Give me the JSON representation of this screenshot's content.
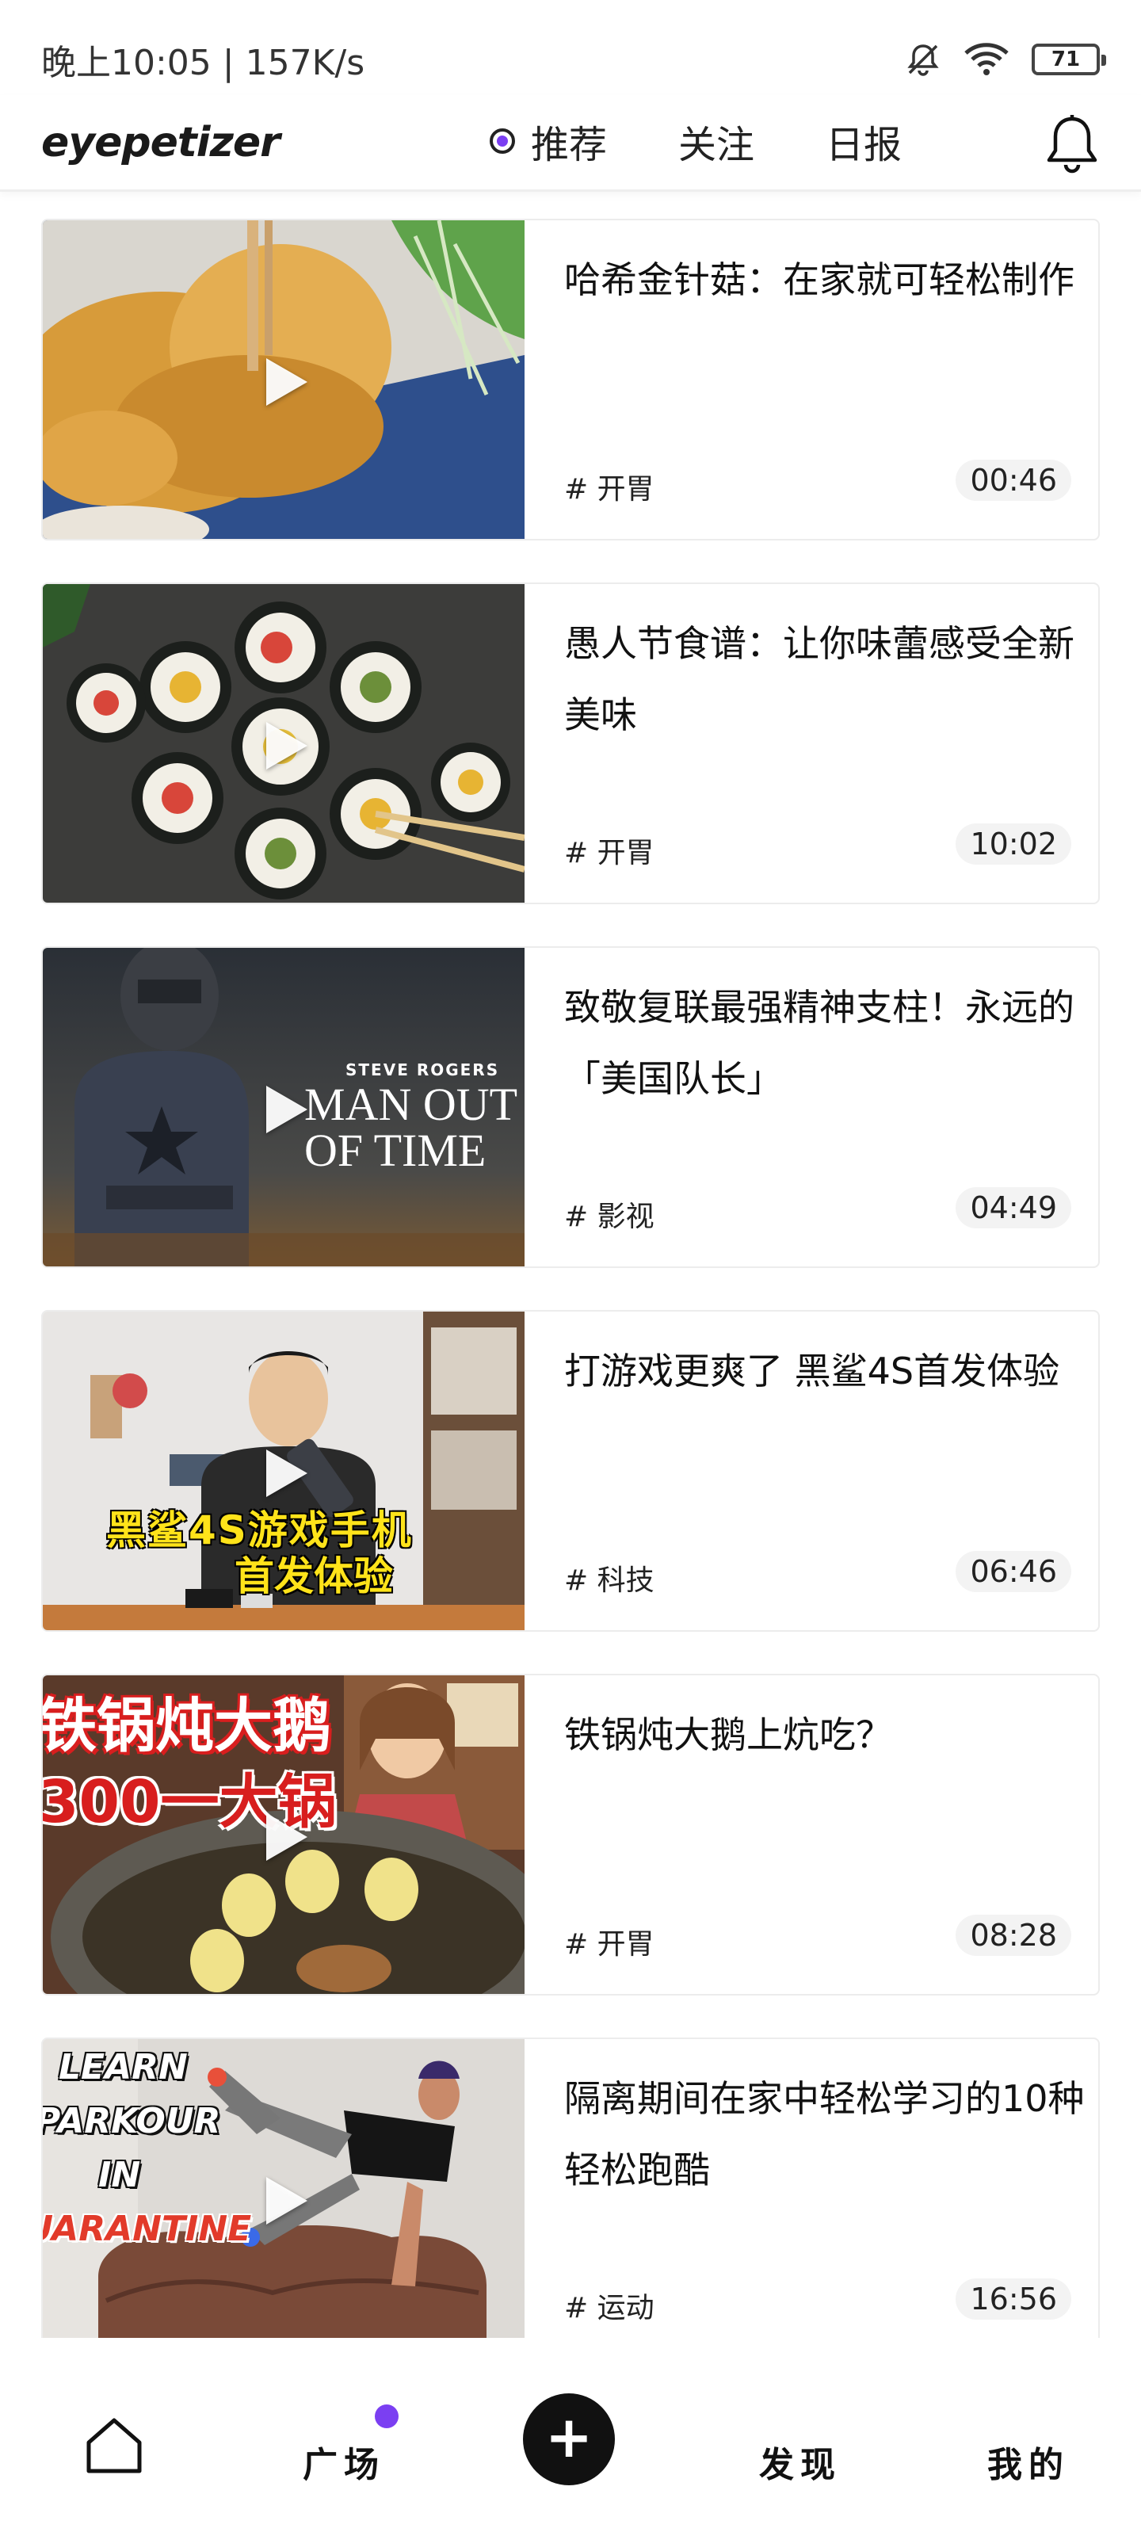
{
  "status_bar": {
    "time_speed": "晚上10:05 | 157K/s",
    "battery": "71"
  },
  "header": {
    "logo": "eyepetizer",
    "tabs": [
      "推荐",
      "关注",
      "日报"
    ]
  },
  "feed": [
    {
      "title": "哈希金针菇：在家就可轻松制作",
      "tag": "# 开胃",
      "duration": "00:46",
      "thumb": "food-fried-mushroom"
    },
    {
      "title": "愚人节食谱：让你味蕾感受全新美味",
      "tag": "# 开胃",
      "duration": "10:02",
      "thumb": "fruit-sushi-rolls"
    },
    {
      "title": "致敬复联最强精神支柱！永远的「美国队长」",
      "tag": "# 影视",
      "duration": "04:49",
      "thumb": "captain-america",
      "thumb_text": {
        "line1": "STEVE ROGERS",
        "line2": "MAN OUT",
        "line3": "OF TIME"
      }
    },
    {
      "title": "打游戏更爽了 黑鲨4S首发体验",
      "tag": "# 科技",
      "duration": "06:46",
      "thumb": "gaming-phone",
      "thumb_text": {
        "line1": "黑鲨4S游戏手机",
        "line2": "首发体验"
      }
    },
    {
      "title": "铁锅炖大鹅上炕吃？",
      "tag": "# 开胃",
      "duration": "08:28",
      "thumb": "iron-pot-goose",
      "thumb_text": {
        "line1": "铁锅炖大鹅",
        "line2": "300一大锅"
      }
    },
    {
      "title": "隔离期间在家中轻松学习的10种轻松跑酷",
      "tag": "# 运动",
      "duration": "16:56",
      "thumb": "parkour",
      "thumb_text": {
        "line1": "LEARN",
        "line2": "PARKOUR",
        "line3": "IN",
        "line4": "QUARANTINE"
      }
    }
  ],
  "bottom_nav": {
    "square": "广场",
    "discover": "发现",
    "mine": "我的"
  },
  "colors": {
    "accent": "#7b3ff2",
    "text": "#111111",
    "card_border": "#ececec"
  }
}
